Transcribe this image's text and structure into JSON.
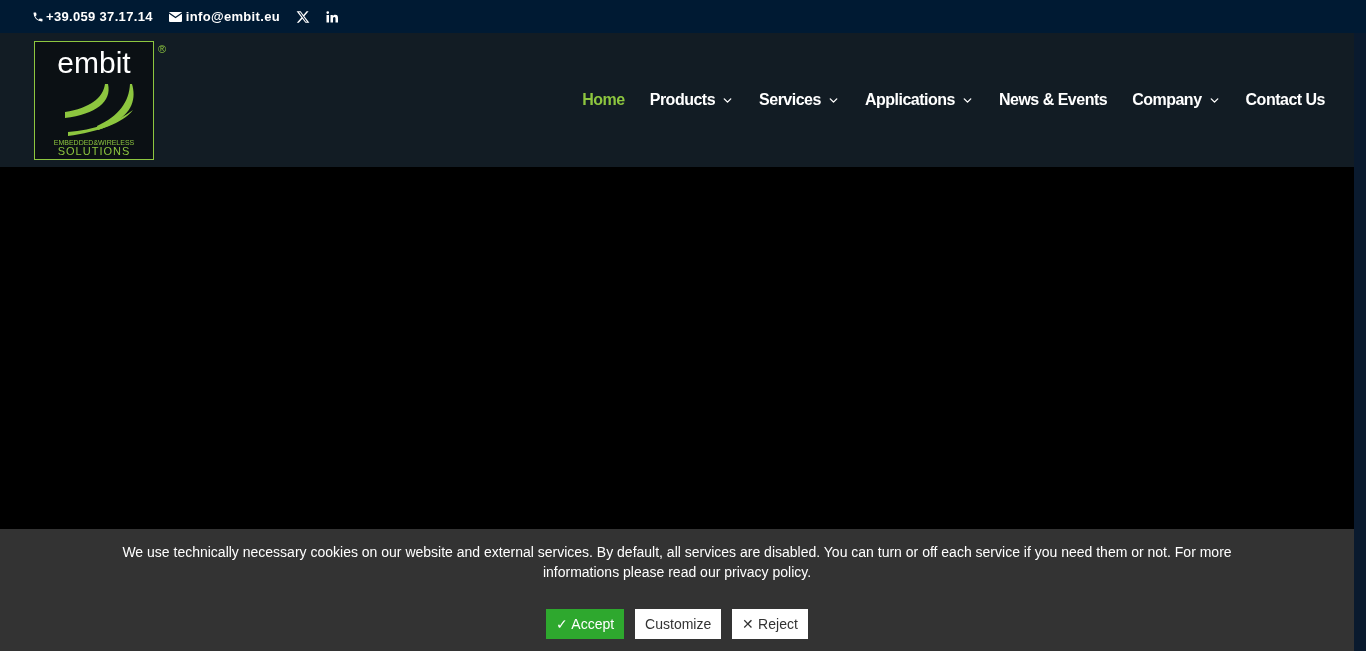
{
  "top_bar": {
    "phone": "+39.059 37.17.14",
    "email": "info@embit.eu"
  },
  "logo": {
    "wordmark": "embit",
    "tagline": "EMBEDDED&WIRELESS",
    "subtitle": "SOLUTIONS",
    "registered": "®"
  },
  "nav": [
    {
      "label": "Home",
      "selected": true,
      "dropdown": false
    },
    {
      "label": "Products",
      "selected": false,
      "dropdown": true
    },
    {
      "label": "Services",
      "selected": false,
      "dropdown": true
    },
    {
      "label": "Applications",
      "selected": false,
      "dropdown": true
    },
    {
      "label": "News & Events",
      "selected": false,
      "dropdown": false
    },
    {
      "label": "Company",
      "selected": false,
      "dropdown": true
    },
    {
      "label": "Contact Us",
      "selected": false,
      "dropdown": false
    }
  ],
  "cookie_banner": {
    "message": "We use technically necessary cookies on our website and external services. By default, all services are disabled. You can turn or off each service if you need them or not. For more informations please read our privacy policy.",
    "buttons": [
      {
        "label": "✓ Accept",
        "kind": "primary"
      },
      {
        "label": "Customize",
        "kind": "secondary"
      },
      {
        "label": "✕ Reject",
        "kind": "secondary"
      }
    ]
  }
}
